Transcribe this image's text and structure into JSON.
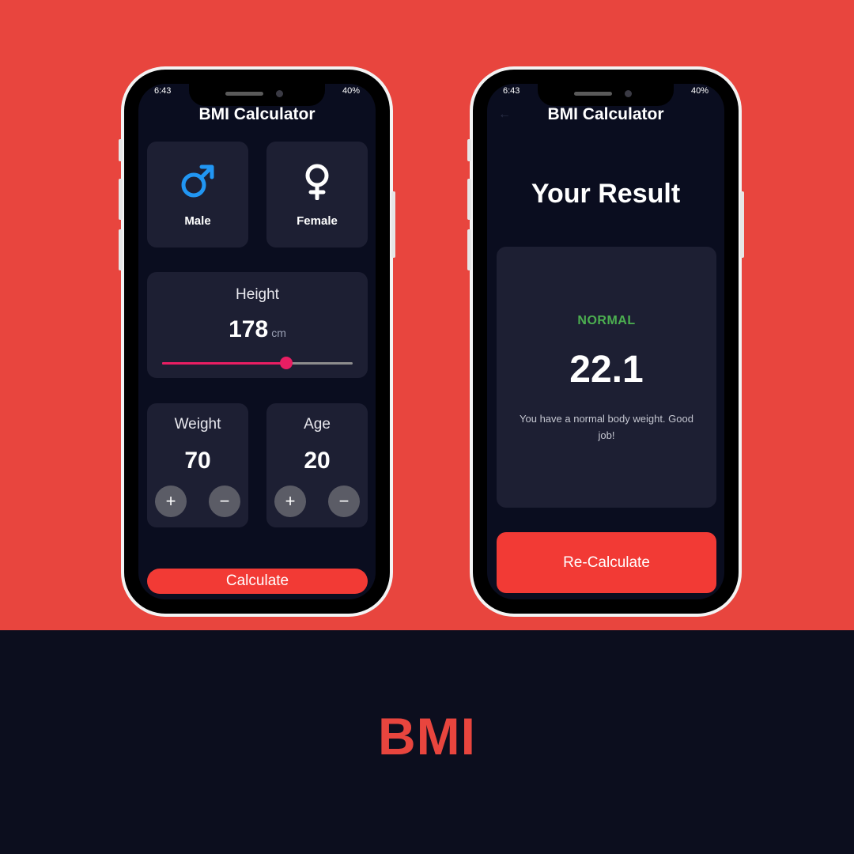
{
  "theme": {
    "background_top": "#e8453e",
    "background_bottom": "#0c0e1e",
    "screen_bg": "#0a0d1f",
    "card_bg": "#1d1f33",
    "accent": "#f23a35",
    "slider_color": "#e91e63",
    "male_icon_color": "#2196f3",
    "normal_color": "#4caf50"
  },
  "brand_text": "BMI",
  "input_screen": {
    "status_bar": {
      "time": "6:43",
      "battery": "40%"
    },
    "title": "BMI Calculator",
    "gender": {
      "male": {
        "label": "Male",
        "icon": "male-symbol-icon"
      },
      "female": {
        "label": "Female",
        "icon": "female-symbol-icon"
      }
    },
    "height": {
      "label": "Height",
      "value": "178",
      "unit": "cm",
      "slider_fraction": 0.65
    },
    "weight": {
      "label": "Weight",
      "value": "70",
      "plus": "+",
      "minus": "−"
    },
    "age": {
      "label": "Age",
      "value": "20",
      "plus": "+",
      "minus": "−"
    },
    "calculate_label": "Calculate"
  },
  "result_screen": {
    "status_bar": {
      "time": "6:43",
      "battery": "40%"
    },
    "title": "BMI Calculator",
    "back_icon": "arrow-left-icon",
    "heading": "Your Result",
    "status": "NORMAL",
    "bmi": "22.1",
    "message": "You have a normal body weight. Good job!",
    "recalculate_label": "Re-Calculate"
  }
}
